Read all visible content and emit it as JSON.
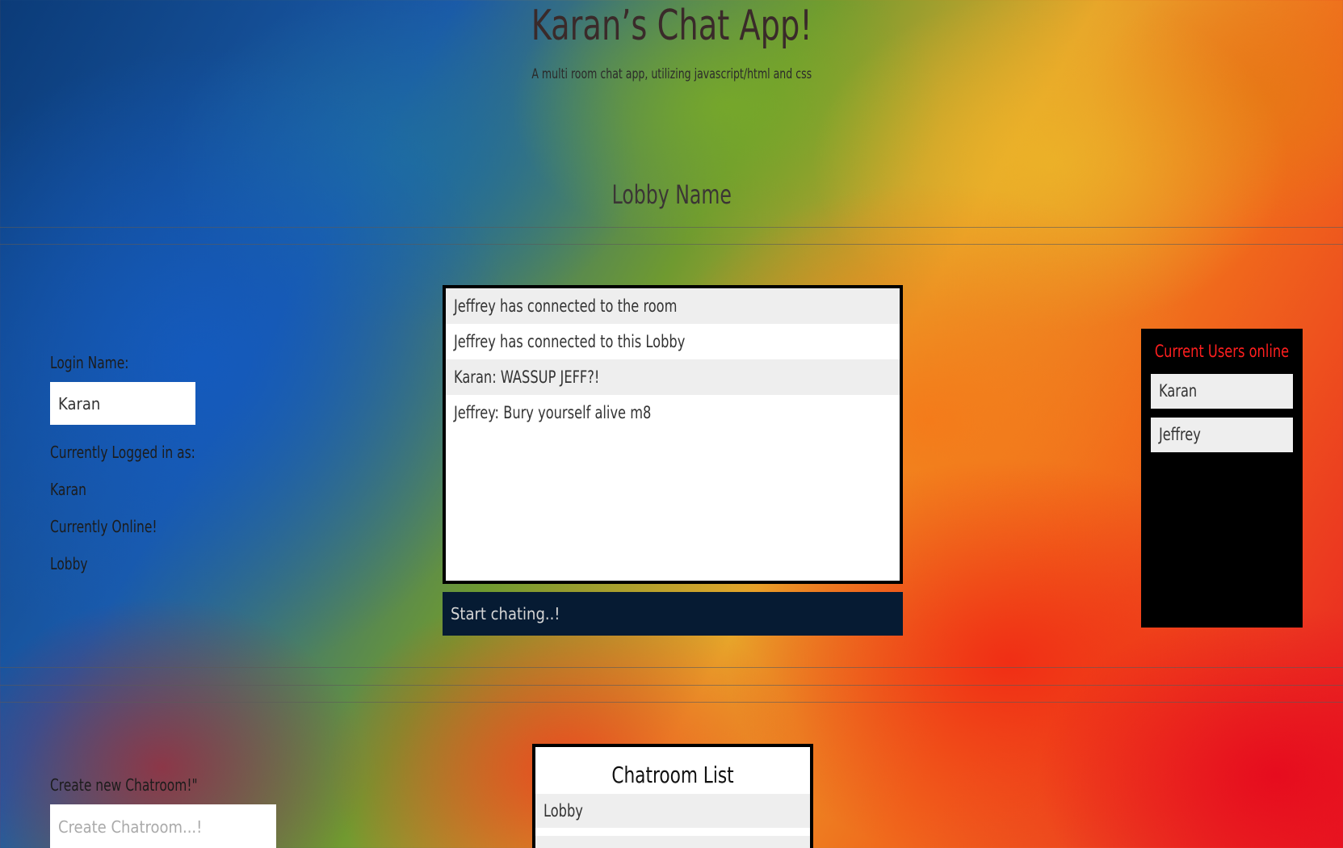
{
  "header": {
    "title": "Karan’s Chat App!",
    "subtitle": "A multi room chat app, utilizing javascript/html and css"
  },
  "lobby": {
    "name": "Lobby Name"
  },
  "login": {
    "label": "Login Name:",
    "value": "Karan",
    "logged_in_label": "Currently Logged in as:",
    "logged_in_user": "Karan",
    "online_label": "Currently Online!",
    "online_room": "Lobby"
  },
  "chat": {
    "messages": [
      "Jeffrey has connected to the room",
      "Jeffrey has connected to this Lobby",
      "Karan: WASSUP JEFF?!",
      "Jeffrey: Bury yourself alive m8"
    ],
    "input_placeholder": "Start chating..!"
  },
  "users": {
    "title": "Current Users online",
    "list": [
      "Karan",
      "Jeffrey"
    ]
  },
  "create_room": {
    "label": "Create new Chatroom!\"",
    "placeholder": "Create Chatroom...!"
  },
  "rooms": {
    "title": "Chatroom List",
    "list": [
      "Lobby",
      ""
    ]
  },
  "colors": {
    "users_title": "#ff1f1f",
    "chat_input_bg": "#061b33",
    "panel_bg": "#000000"
  }
}
